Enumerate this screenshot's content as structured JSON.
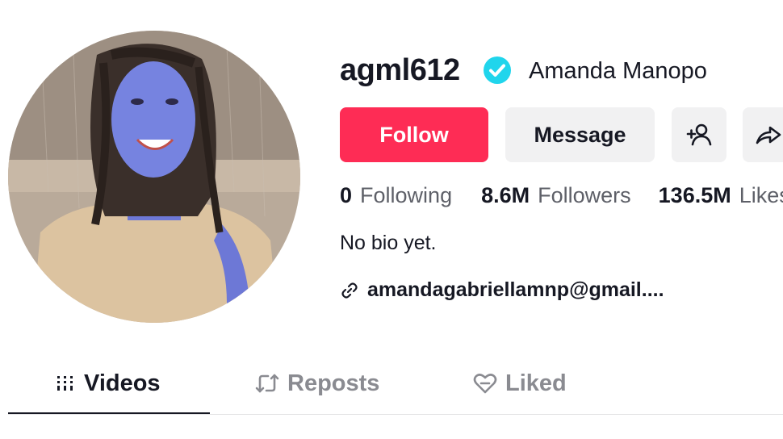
{
  "profile": {
    "username": "agml612",
    "nickname": "Amanda Manopo",
    "verified": true,
    "bio": "No bio yet.",
    "link": "amandagabriellamnp@gmail...."
  },
  "actions": {
    "follow_label": "Follow",
    "message_label": "Message",
    "add_friend_icon": "add-user-icon",
    "share_icon": "share-icon"
  },
  "stats": {
    "following_count": "0",
    "following_label": "Following",
    "followers_count": "8.6M",
    "followers_label": "Followers",
    "likes_count": "136.5M",
    "likes_label": "Likes"
  },
  "tabs": [
    {
      "label": "Videos",
      "icon": "grid-icon",
      "active": true
    },
    {
      "label": "Reposts",
      "icon": "repost-icon",
      "active": false
    },
    {
      "label": "Liked",
      "icon": "heart-icon",
      "active": false
    }
  ],
  "colors": {
    "accent": "#fe2c55",
    "verified": "#20d5ec",
    "secondary_button": "#f1f1f2",
    "muted_text": "#8a8b91"
  }
}
